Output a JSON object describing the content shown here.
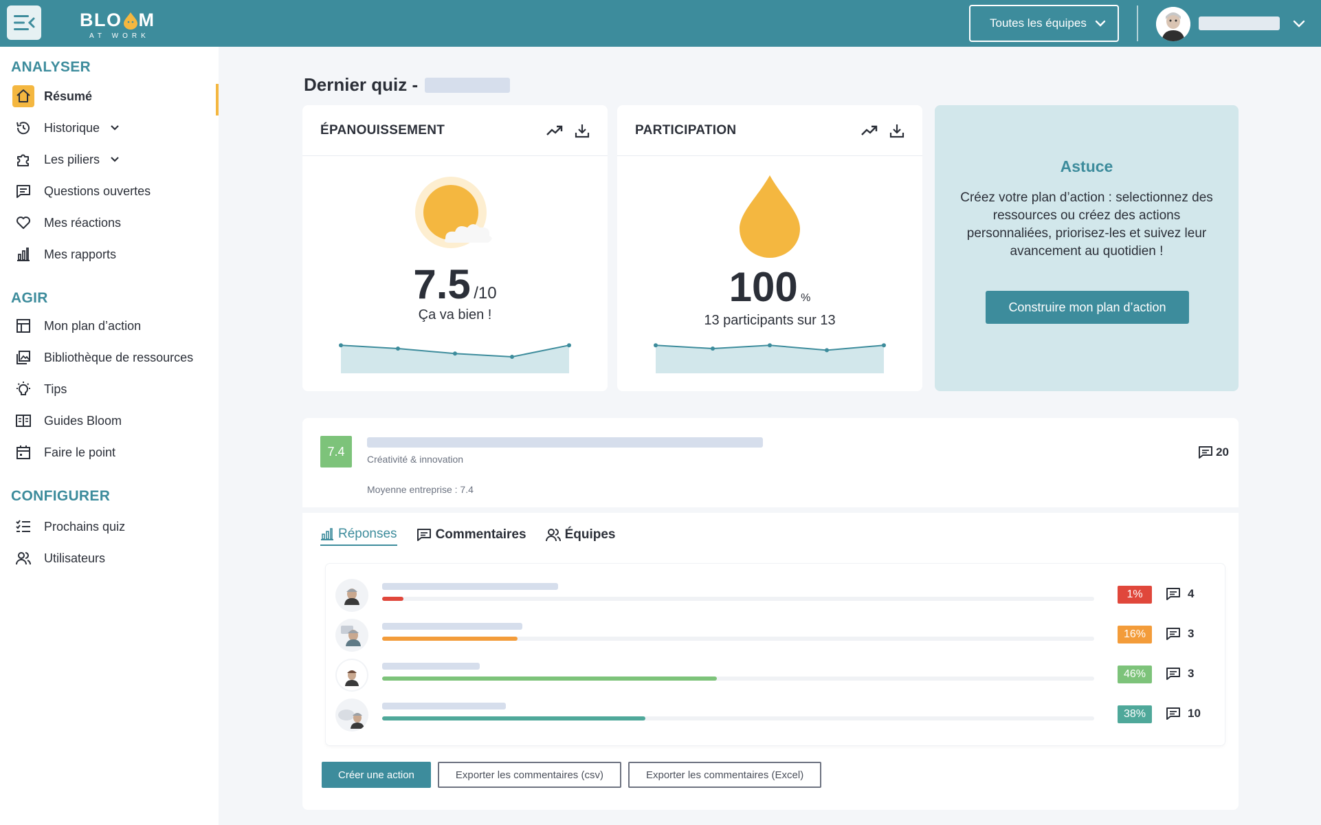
{
  "header": {
    "logo_word_left": "BLO",
    "logo_word_right": "M",
    "logo_sub": "AT WORK",
    "team_select": "Toutes les équipes"
  },
  "sidebar": {
    "sections": [
      {
        "title": "ANALYSER"
      },
      {
        "title": "AGIR"
      },
      {
        "title": "CONFIGURER"
      }
    ],
    "items": [
      {
        "label": "Résumé"
      },
      {
        "label": "Historique"
      },
      {
        "label": "Les piliers"
      },
      {
        "label": "Questions ouvertes"
      },
      {
        "label": "Mes réactions"
      },
      {
        "label": "Mes rapports"
      },
      {
        "label": "Mon plan d’action"
      },
      {
        "label": "Bibliothèque de ressources"
      },
      {
        "label": "Tips"
      },
      {
        "label": "Guides Bloom"
      },
      {
        "label": "Faire le point"
      },
      {
        "label": "Prochains quiz"
      },
      {
        "label": "Utilisateurs"
      }
    ]
  },
  "main": {
    "title": "Dernier quiz -",
    "epanouissement": {
      "title": "ÉPANOUISSEMENT",
      "value": "7.5",
      "scale": "/10",
      "caption": "Ça va bien !",
      "trend": [
        0.6,
        0.5,
        0.35,
        0.25,
        0.6
      ]
    },
    "participation": {
      "title": "PARTICIPATION",
      "value": "100",
      "unit": "%",
      "caption": "13 participants sur 13",
      "trend": [
        0.6,
        0.5,
        0.6,
        0.45,
        0.6
      ]
    },
    "tip": {
      "title": "Astuce",
      "text": "Créez votre plan d’action : selectionnez des ressources ou créez des actions personnaliées, priorisez-les et suivez leur avancement au quotidien !",
      "button": "Construire mon plan d’action"
    },
    "question": {
      "score": "7.4",
      "category": "Créativité & innovation",
      "average": "Moyenne entreprise : 7.4",
      "comments": "20"
    },
    "tabs": [
      {
        "label": "Réponses"
      },
      {
        "label": "Commentaires"
      },
      {
        "label": "Équipes"
      }
    ],
    "responses": [
      {
        "pct": "1%",
        "value": 0.03,
        "color": "#e0473b",
        "count": "4"
      },
      {
        "pct": "16%",
        "value": 0.19,
        "color": "#f39c3a",
        "count": "3"
      },
      {
        "pct": "46%",
        "value": 0.47,
        "color": "#7dc37a",
        "count": "3"
      },
      {
        "pct": "38%",
        "value": 0.37,
        "color": "#4fa89a",
        "count": "10"
      }
    ],
    "actions": {
      "create": "Créer une action",
      "export_csv": "Exporter les commentaires (csv)",
      "export_excel": "Exporter les commentaires (Excel)"
    }
  }
}
